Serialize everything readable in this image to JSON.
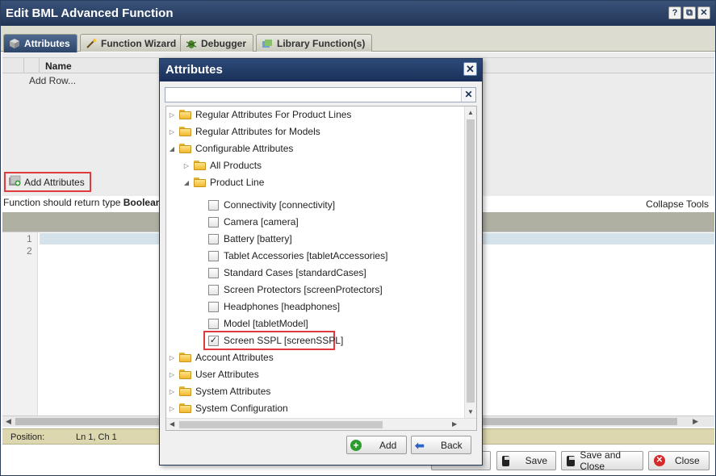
{
  "window": {
    "title": "Edit BML Advanced Function",
    "buttons": [
      "?",
      "⧉",
      "✕"
    ]
  },
  "tabs": [
    {
      "label": "Attributes",
      "icon": "cube-icon",
      "active": true
    },
    {
      "label": "Function Wizard",
      "icon": "wand-icon",
      "active": false
    },
    {
      "label": "Debugger",
      "icon": "bug-icon",
      "active": false
    },
    {
      "label": "Library Function(s)",
      "icon": "library-icon",
      "active": false
    }
  ],
  "attributes_panel": {
    "column_name": "Name",
    "add_row": "Add Row...",
    "add_attributes_button": "Add Attributes"
  },
  "function_return": {
    "prefix": "Function should return type ",
    "type": "Boolean"
  },
  "collapse_tools": "Collapse Tools",
  "editor": {
    "line_numbers": [
      "1",
      "2"
    ]
  },
  "status": {
    "position_label": "Position:",
    "position_value": "Ln 1, Ch 1"
  },
  "footer_buttons": {
    "save": "Save",
    "save_and_close": "Save and Close",
    "close": "Close"
  },
  "dialog": {
    "title": "Attributes",
    "search_value": "",
    "tree": [
      {
        "label": "Regular Attributes For Product Lines",
        "kind": "folder",
        "expanded": false
      },
      {
        "label": "Regular Attributes for Models",
        "kind": "folder",
        "expanded": false
      },
      {
        "label": "Configurable Attributes",
        "kind": "folder",
        "expanded": true
      },
      {
        "label": "All Products",
        "kind": "folder",
        "expanded": false
      },
      {
        "label": "Product Line",
        "kind": "folder",
        "expanded": true
      },
      {
        "label": "Connectivity [connectivity]",
        "kind": "checkbox",
        "checked": false
      },
      {
        "label": "Camera [camera]",
        "kind": "checkbox",
        "checked": false
      },
      {
        "label": "Battery [battery]",
        "kind": "checkbox",
        "checked": false
      },
      {
        "label": "Tablet Accessories [tabletAccessories]",
        "kind": "checkbox",
        "checked": false
      },
      {
        "label": "Standard Cases [standardCases]",
        "kind": "checkbox",
        "checked": false
      },
      {
        "label": "Screen Protectors [screenProtectors]",
        "kind": "checkbox",
        "checked": false
      },
      {
        "label": "Headphones [headphones]",
        "kind": "checkbox",
        "checked": false
      },
      {
        "label": "Model [tabletModel]",
        "kind": "checkbox",
        "checked": false
      },
      {
        "label": "Screen SSPL [screenSSPL]",
        "kind": "checkbox",
        "checked": true
      },
      {
        "label": "Account Attributes",
        "kind": "folder",
        "expanded": false
      },
      {
        "label": "User Attributes",
        "kind": "folder",
        "expanded": false
      },
      {
        "label": "System Attributes",
        "kind": "folder",
        "expanded": false
      },
      {
        "label": "System Configuration",
        "kind": "folder",
        "expanded": false
      }
    ],
    "add_button": "Add",
    "back_button": "Back"
  },
  "colors": {
    "title_bar": "#203658",
    "highlight": "#e0393e",
    "status_bar": "#dcd7ae"
  }
}
